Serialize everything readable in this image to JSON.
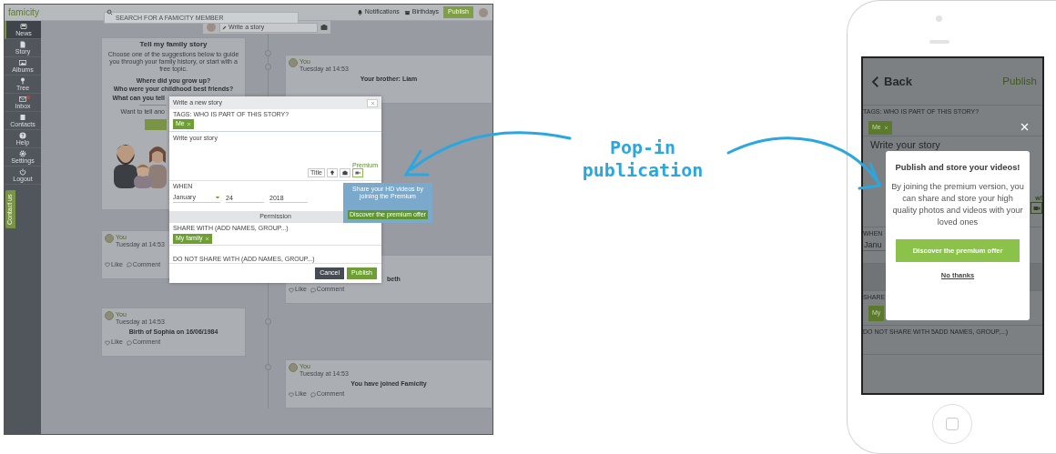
{
  "web_app": {
    "header": {
      "logo": "famicity",
      "search": {
        "placeholder": "SEARCH FOR A FAMICITY MEMBER"
      },
      "links": [
        {
          "kind": "bell",
          "label": "Notifications"
        },
        {
          "kind": "gift",
          "label": "Birthdays"
        }
      ],
      "publish_button": "Publish"
    },
    "sidebar": [
      {
        "kind": "news",
        "label": "News",
        "selected": true,
        "unread": false
      },
      {
        "kind": "story",
        "label": "Story",
        "selected": false,
        "unread": false
      },
      {
        "kind": "albums",
        "label": "Albums",
        "selected": false,
        "unread": false
      },
      {
        "kind": "tree",
        "label": "Tree",
        "selected": false,
        "unread": false
      },
      {
        "kind": "inbox",
        "label": "Inbox",
        "selected": false,
        "unread": true
      },
      {
        "kind": "contacts",
        "label": "Contacts",
        "selected": false,
        "unread": false
      },
      {
        "kind": "help",
        "label": "Help",
        "selected": false,
        "unread": false
      },
      {
        "kind": "settings",
        "label": "Settings",
        "selected": false,
        "unread": false
      },
      {
        "kind": "logout",
        "label": "Logout",
        "selected": false,
        "unread": false
      }
    ],
    "contact_tab": "Contact us",
    "write_bar": {
      "placeholder": "Write a story"
    },
    "prompt_card": {
      "title": "Tell my family story",
      "text": "Choose one of the suggestions below to guide you through your family history, or start with a free topic.",
      "questions": [
        "Where did you grow up?",
        "Who were your childhood best friends?"
      ],
      "cut_question": "What can you tell",
      "more": "Want to tell ano"
    },
    "left_posts": [
      {
        "author": "You",
        "time": "Tuesday at 14:53",
        "actions": [
          "Like",
          "Comment"
        ]
      },
      {
        "author": "You",
        "time": "Tuesday at 14:53",
        "title": "Birth of Sophia on 16/06/1984",
        "actions": [
          "Like",
          "Comment"
        ]
      }
    ],
    "right_posts": [
      {
        "author": "You",
        "time": "Tuesday at 14:53",
        "title": "Your brother: Liam"
      },
      {
        "title": "beth",
        "actions": [
          "Like",
          "Comment"
        ]
      },
      {
        "author": "You",
        "time": "Tuesday at 14:53",
        "title": "You have joined Famicity",
        "actions": [
          "Like",
          "Comment"
        ]
      }
    ],
    "modal": {
      "title": "Write a new story",
      "tags_label": "TAGS: WHO IS PART OF THIS STORY?",
      "tags": [
        "Me"
      ],
      "story": {
        "placeholder": "Write your story"
      },
      "tools": [
        {
          "kind": "title",
          "label": "Title"
        },
        {
          "kind": "idea"
        },
        {
          "kind": "photo"
        },
        {
          "kind": "video",
          "premium_label": "Premium"
        }
      ],
      "when": {
        "label": "WHEN",
        "month": "January",
        "day": "24",
        "year": "2018"
      },
      "permission_header": "Permission",
      "share": {
        "label": "SHARE WITH (ADD NAMES, GROUP...)",
        "tags": [
          "My family"
        ]
      },
      "do_not_share": {
        "label": "DO NOT SHARE WITH (ADD NAMES, GROUP...)"
      },
      "buttons": [
        {
          "kind": "secondary",
          "label": "Cancel"
        },
        {
          "kind": "primary",
          "label": "Publish"
        }
      ]
    },
    "tooltip": {
      "text": "Share your HD videos by joining the Premium",
      "button": "Discover the premium offer"
    }
  },
  "callout": {
    "lines": [
      "Pop-in",
      "publication"
    ]
  },
  "phone": {
    "nav": {
      "back": "Back",
      "action": "Publish"
    },
    "tags_label": "TAGS: WHO IS PART OF THIS STORY?",
    "tags": [
      "Me"
    ],
    "story": {
      "placeholder": "Write your story"
    },
    "premium_label": "w!",
    "when": {
      "label": "WHEN",
      "month": "Janu"
    },
    "share": {
      "label": "SHARE",
      "tags": [
        "My"
      ]
    },
    "do_not_share": {
      "label": "DO NOT SHARE WITH 5ADD NAMES, GROUP,...)"
    },
    "popup": {
      "title": "Publish and store your videos!",
      "text": "By joining the premium version, you can share and store your high quality photos and videos with your loved ones",
      "button": "Discover the premium offer",
      "dismiss": "No thanks"
    }
  }
}
